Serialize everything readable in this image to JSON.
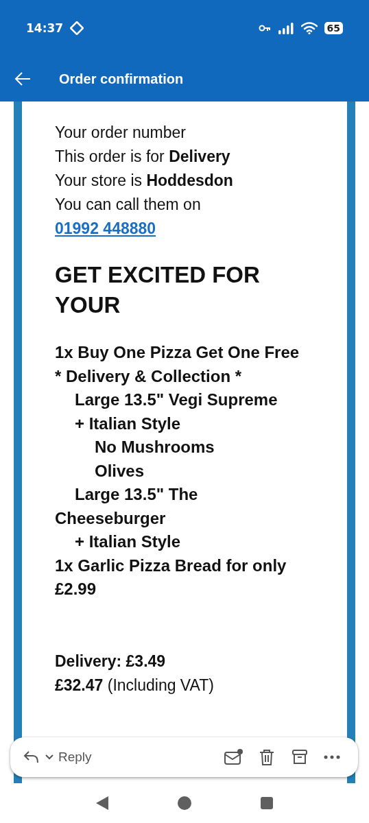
{
  "status_bar": {
    "time": "14:37",
    "battery": "65"
  },
  "app_bar": {
    "title": "Order confirmation"
  },
  "email": {
    "intro": [
      "Your order number",
      "This order is for **Delivery**",
      "Your store is **Hoddesdon**"
    ],
    "call_text": "You can call them on",
    "phone": "01992 448880",
    "heading": "GET EXCITED FOR YOUR",
    "items": [
      {
        "text": "1x Buy One Pizza Get One Free * Delivery & Collection *",
        "children": [
          {
            "text": "Large 13.5\" Vegi Supreme"
          },
          {
            "text": "+ Italian Style",
            "children": [
              {
                "text": "No Mushrooms"
              },
              {
                "text": "Olives"
              }
            ]
          },
          {
            "text": "Large 13.5\" The Cheeseburger"
          },
          {
            "text": "+ Italian Style"
          }
        ]
      },
      {
        "text": "1x Garlic Pizza Bread for only £2.99"
      }
    ],
    "delivery": "Delivery: £3.49",
    "total": "**£32.47** (Including VAT)"
  },
  "toolbar": {
    "reply": "Reply"
  }
}
